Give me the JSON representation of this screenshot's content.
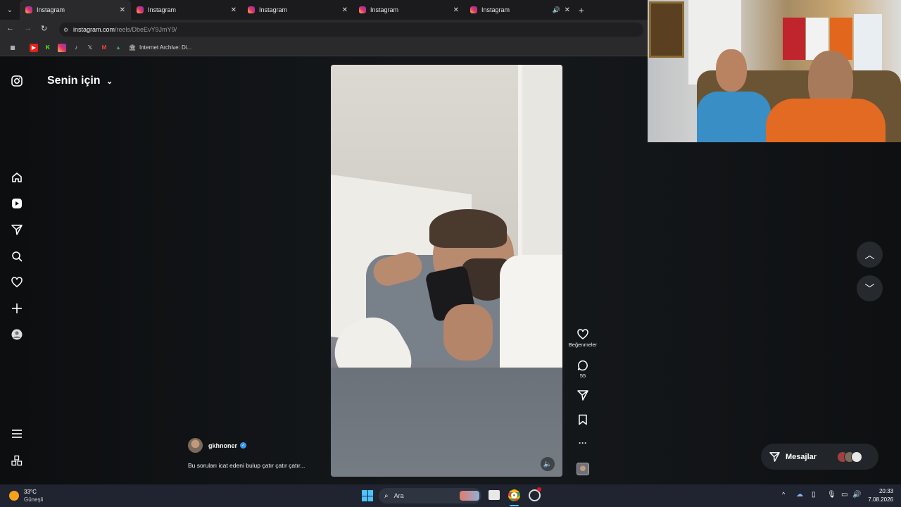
{
  "browser": {
    "tabs": [
      {
        "title": "Instagram"
      },
      {
        "title": "Instagram"
      },
      {
        "title": "Instagram"
      },
      {
        "title": "Instagram"
      },
      {
        "title": "Instagram"
      }
    ],
    "address_host": "instagram.com",
    "address_path": "/reels/DbeEvY9JmY9/",
    "bookmark_label": "Internet Archive: Di..."
  },
  "instagram": {
    "feed_title": "Senin için",
    "post": {
      "username": "gkhnoner",
      "caption": "Bu soruları icat edeni bulup çatır çatır çatır...",
      "like_label": "Beğenmeler",
      "comment_count": "55"
    },
    "messages_label": "Mesajlar"
  },
  "taskbar": {
    "temp": "33°C",
    "weather": "Güneşli",
    "search_placeholder": "Ara",
    "time": "20:33",
    "date": "7.08.2026"
  }
}
